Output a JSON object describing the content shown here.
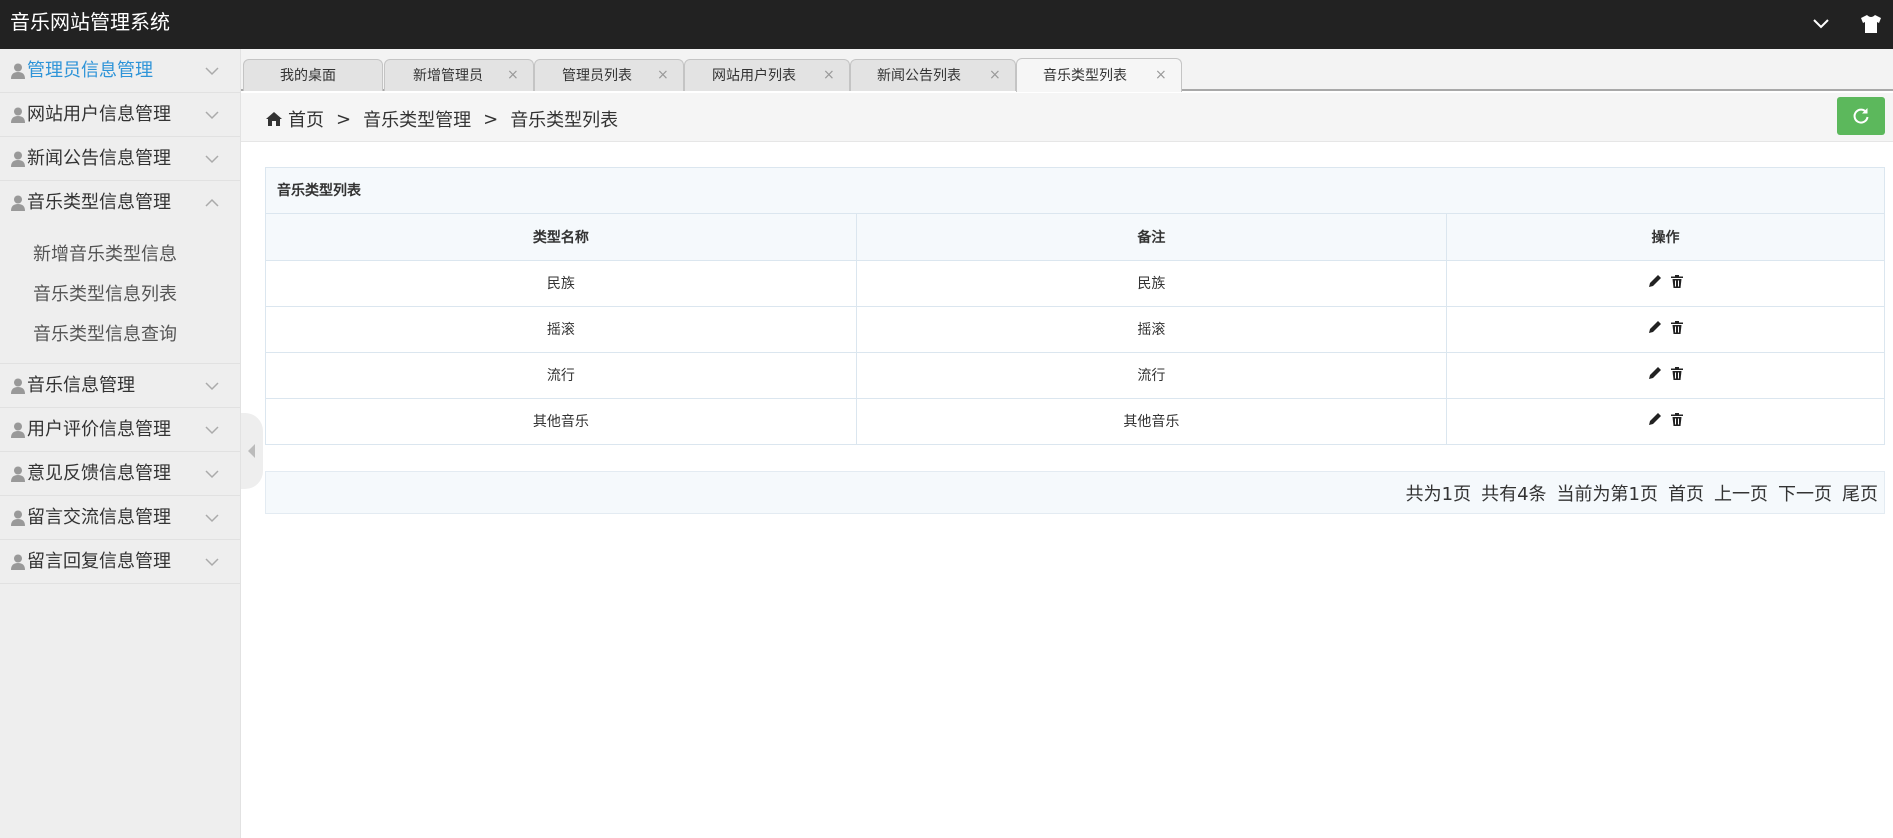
{
  "header": {
    "title": "音乐网站管理系统",
    "icons": [
      "chevron-down-icon",
      "tshirt-icon"
    ]
  },
  "sidebar": {
    "items": [
      {
        "label": "管理员信息管理",
        "active": true
      },
      {
        "label": "网站用户信息管理"
      },
      {
        "label": "新闻公告信息管理"
      },
      {
        "label": "音乐类型信息管理",
        "expanded": true,
        "children": [
          "新增音乐类型信息",
          "音乐类型信息列表",
          "音乐类型信息查询"
        ]
      },
      {
        "label": "音乐信息管理"
      },
      {
        "label": "用户评价信息管理"
      },
      {
        "label": "意见反馈信息管理"
      },
      {
        "label": "留言交流信息管理"
      },
      {
        "label": "留言回复信息管理"
      }
    ]
  },
  "tabs": [
    {
      "label": "我的桌面",
      "closable": false
    },
    {
      "label": "新增管理员",
      "closable": true
    },
    {
      "label": "管理员列表",
      "closable": true
    },
    {
      "label": "网站用户列表",
      "closable": true
    },
    {
      "label": "新闻公告列表",
      "closable": true
    },
    {
      "label": "音乐类型列表",
      "closable": true,
      "active": true
    }
  ],
  "tab_close_glyph": "×",
  "breadcrumb": {
    "home": "首页",
    "sep": ">",
    "level1": "音乐类型管理",
    "level2": "音乐类型列表"
  },
  "panel": {
    "title": "音乐类型列表",
    "columns": [
      "类型名称",
      "备注",
      "操作"
    ],
    "rows": [
      {
        "name": "民族",
        "remark": "民族"
      },
      {
        "name": "摇滚",
        "remark": "摇滚"
      },
      {
        "name": "流行",
        "remark": "流行"
      },
      {
        "name": "其他音乐",
        "remark": "其他音乐"
      }
    ]
  },
  "pager": {
    "total_pages": "共为1页",
    "total_records": "共有4条",
    "current": "当前为第1页",
    "first": "首页",
    "prev": "上一页",
    "next": "下一页",
    "last": "尾页"
  },
  "colors": {
    "header_bg": "#222222",
    "accent": "#2e94d8",
    "refresh_btn": "#5cb85c",
    "sidebar_bg": "#eeeeee"
  }
}
